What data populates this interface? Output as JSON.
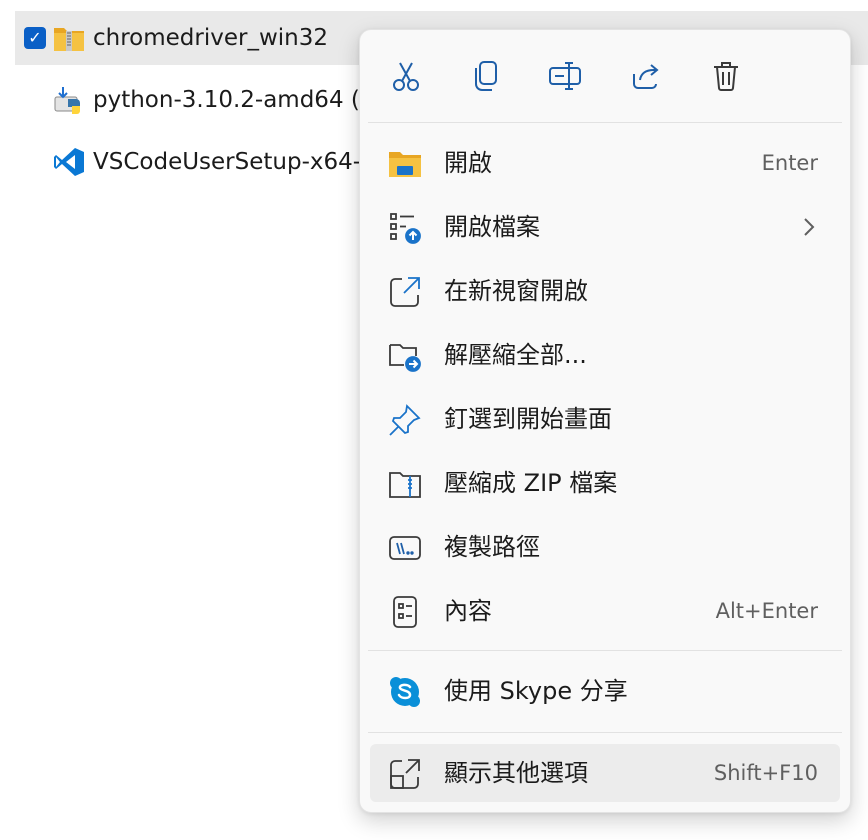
{
  "files": [
    {
      "name": "chromedriver_win32",
      "icon": "zip-folder-icon",
      "selected": true
    },
    {
      "name": "python-3.10.2-amd64 (",
      "icon": "python-installer-icon",
      "selected": false
    },
    {
      "name": "VSCodeUserSetup-x64-",
      "icon": "vscode-icon",
      "selected": false
    }
  ],
  "checkbox_glyph": "✓",
  "context_menu": {
    "toolbar": [
      {
        "name": "cut",
        "icon": "scissors-icon"
      },
      {
        "name": "copy",
        "icon": "copy-icon"
      },
      {
        "name": "rename",
        "icon": "rename-icon"
      },
      {
        "name": "share",
        "icon": "share-icon"
      },
      {
        "name": "delete",
        "icon": "trash-icon"
      }
    ],
    "items": [
      {
        "label": "開啟",
        "shortcut": "Enter",
        "icon": "folder-icon"
      },
      {
        "label": "開啟檔案",
        "submenu": true,
        "icon": "open-with-icon"
      },
      {
        "label": "在新視窗開啟",
        "icon": "new-window-icon"
      },
      {
        "label": "解壓縮全部...",
        "icon": "extract-folder-icon"
      },
      {
        "label": "釘選到開始畫面",
        "icon": "pin-icon"
      },
      {
        "label": "壓縮成 ZIP 檔案",
        "icon": "zip-compress-icon"
      },
      {
        "label": "複製路徑",
        "icon": "copy-path-icon"
      },
      {
        "label": "內容",
        "shortcut": "Alt+Enter",
        "icon": "properties-icon"
      },
      {
        "label": "使用 Skype 分享",
        "icon": "skype-icon"
      },
      {
        "label": "顯示其他選項",
        "shortcut": "Shift+F10",
        "icon": "more-options-icon"
      }
    ]
  },
  "colors": {
    "accent": "#0a5fc6",
    "folder": "#f5c242",
    "skype": "#0a8fd8"
  }
}
